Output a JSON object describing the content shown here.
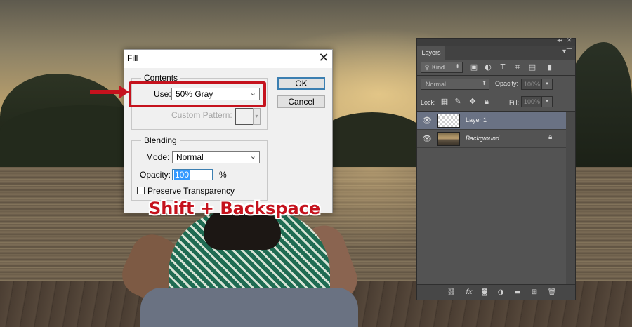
{
  "fill_dialog": {
    "title": "Fill",
    "close_glyph": "✕",
    "contents_legend": "Contents",
    "use_label": "Use:",
    "use_value": "50% Gray",
    "custom_pattern_label": "Custom Pattern:",
    "blending_legend": "Blending",
    "mode_label": "Mode:",
    "mode_value": "Normal",
    "opacity_label": "Opacity:",
    "opacity_value": "100",
    "opacity_unit": "%",
    "preserve_transparency_label": "Preserve Transparency",
    "preserve_transparency_checked": false,
    "ok_label": "OK",
    "cancel_label": "Cancel"
  },
  "annotation": {
    "shortcut_text": "Shift + Backspace",
    "highlight_color": "#c5121d"
  },
  "layers_panel": {
    "tab_label": "Layers",
    "kind_filter": "Kind",
    "blend_mode": "Normal",
    "opacity_label": "Opacity:",
    "opacity_value": "100%",
    "lock_label": "Lock:",
    "fill_label": "Fill:",
    "fill_value": "100%",
    "layers": [
      {
        "name": "Layer 1",
        "selected": true,
        "visible": true,
        "thumbnail": "transparent"
      },
      {
        "name": "Background",
        "selected": false,
        "visible": true,
        "thumbnail": "photo",
        "locked": true
      }
    ],
    "filter_icons": [
      "pixel-filter-icon",
      "adjustment-filter-icon",
      "type-filter-icon",
      "shape-filter-icon",
      "smart-object-filter-icon",
      "filter-toggle-icon"
    ],
    "lock_icons": [
      "lock-transparent-pixels-icon",
      "lock-image-pixels-icon",
      "lock-position-icon",
      "lock-all-icon"
    ],
    "bottom_icons": [
      "link-layers-icon",
      "fx-icon",
      "add-mask-icon",
      "new-adjustment-layer-icon",
      "new-group-icon",
      "new-layer-icon",
      "delete-layer-icon"
    ],
    "selected_row_color": "#6a7284",
    "panel_color": "#535353"
  }
}
